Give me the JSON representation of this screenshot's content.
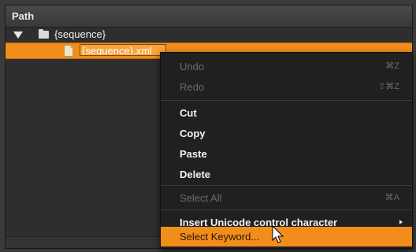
{
  "panel": {
    "header_title": "Path"
  },
  "tree": {
    "folder_label": "{sequence}",
    "file_label": "{sequence}.xml"
  },
  "context_menu": {
    "items": [
      {
        "label": "Undo",
        "shortcut": "⌘Z",
        "enabled": false
      },
      {
        "label": "Redo",
        "shortcut": "⇧⌘Z",
        "enabled": false
      },
      {
        "label": "Cut",
        "shortcut": "",
        "enabled": true
      },
      {
        "label": "Copy",
        "shortcut": "",
        "enabled": true
      },
      {
        "label": "Paste",
        "shortcut": "",
        "enabled": true
      },
      {
        "label": "Delete",
        "shortcut": "",
        "enabled": true
      },
      {
        "label": "Select All",
        "shortcut": "⌘A",
        "enabled": false
      },
      {
        "label": "Insert Unicode control character",
        "shortcut": "",
        "enabled": true,
        "has_submenu": true
      },
      {
        "label": "Select Keyword...",
        "shortcut": "",
        "enabled": true,
        "highlighted": true
      }
    ]
  },
  "colors": {
    "accent": "#f08d1b",
    "menu_bg": "#202020",
    "panel_bg": "#2e2e2e"
  }
}
